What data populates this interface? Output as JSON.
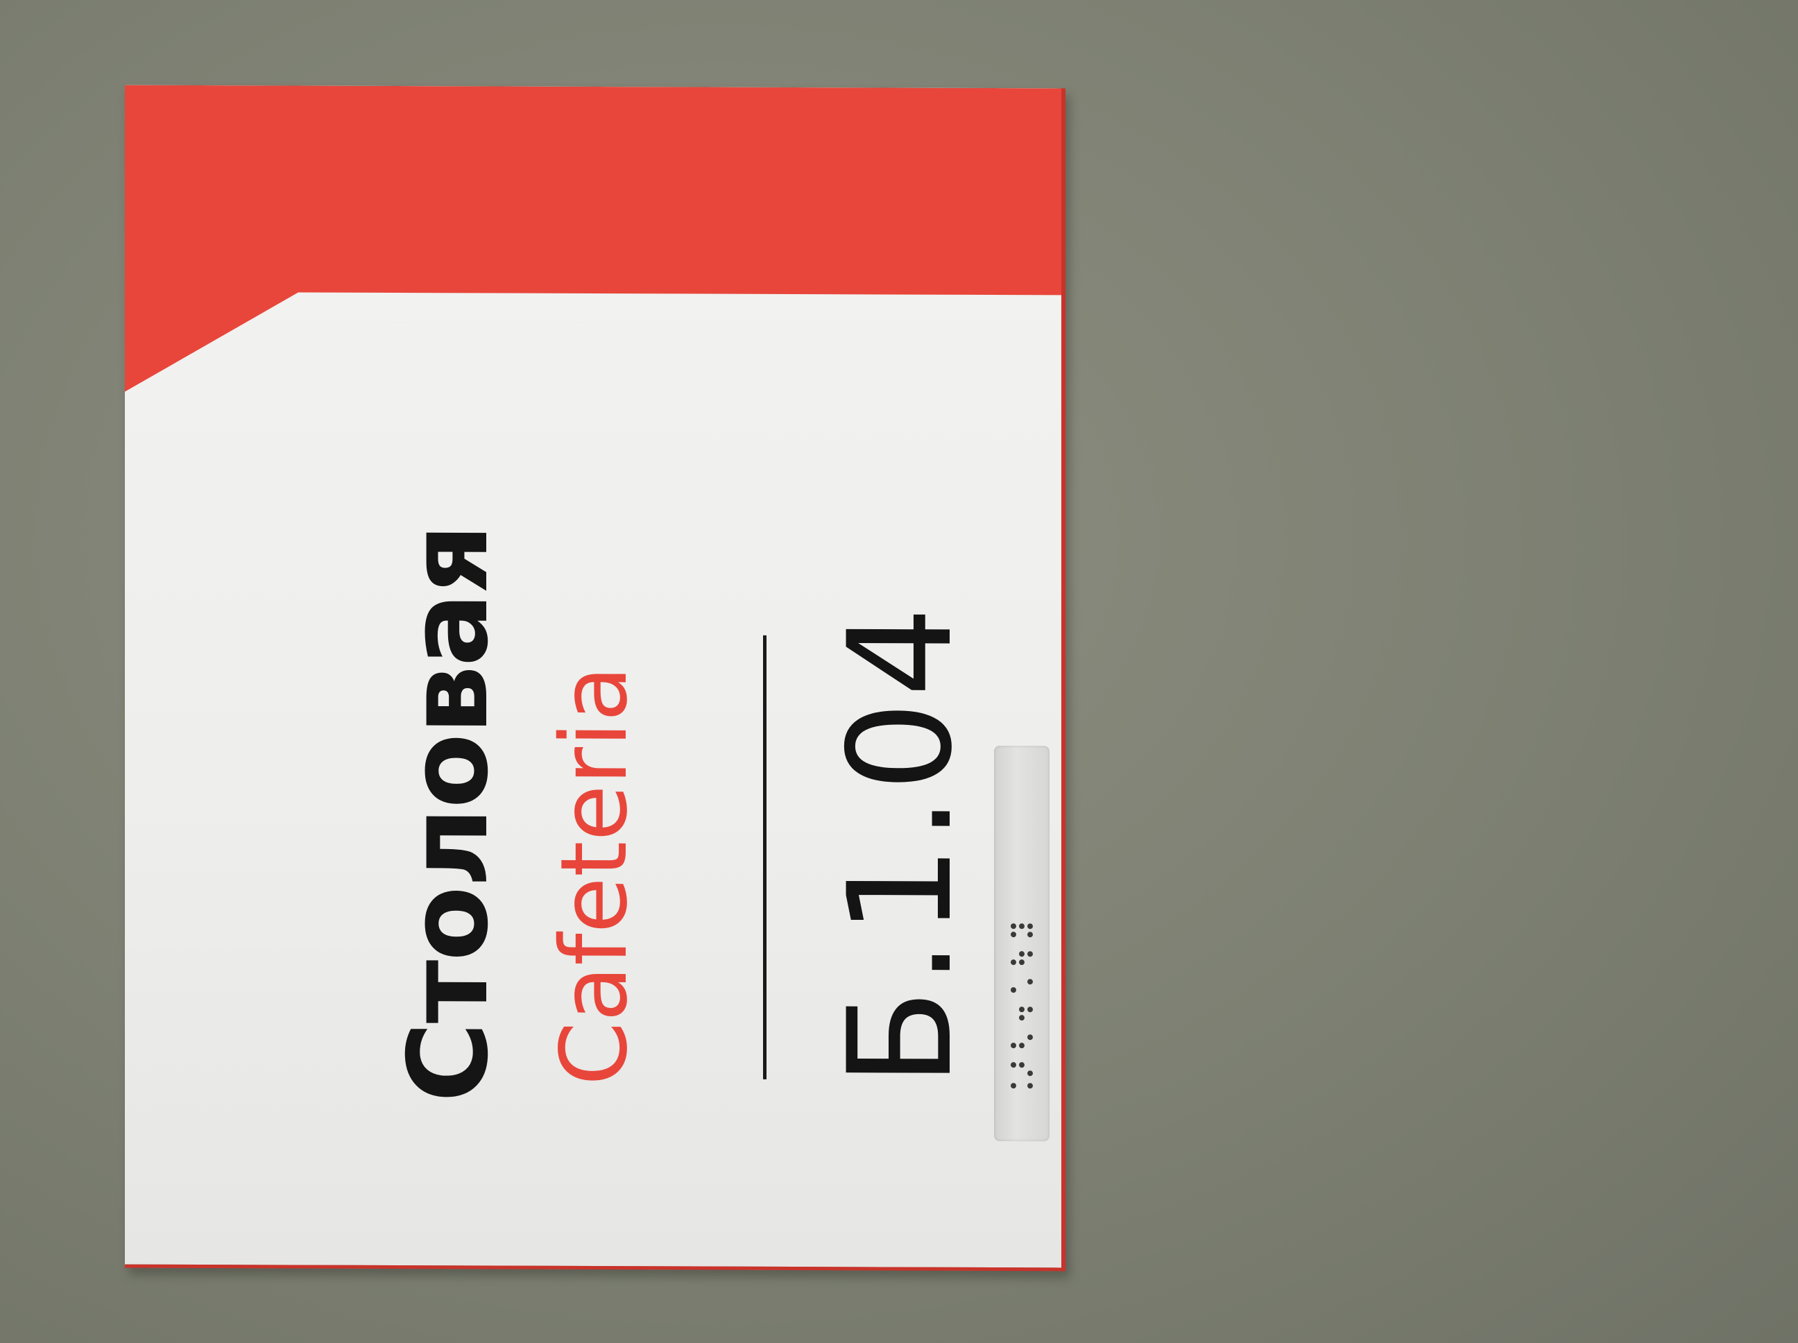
{
  "sign": {
    "name_ru": "Столовая",
    "name_en": "Cafeteria",
    "room_number": "Б.1.04"
  },
  "colors": {
    "wall": "#7f8275",
    "sign_face": "#f1f1f0",
    "accent_red": "#e8463b",
    "text_dark": "#151515"
  },
  "braille_icon": "braille-dots"
}
